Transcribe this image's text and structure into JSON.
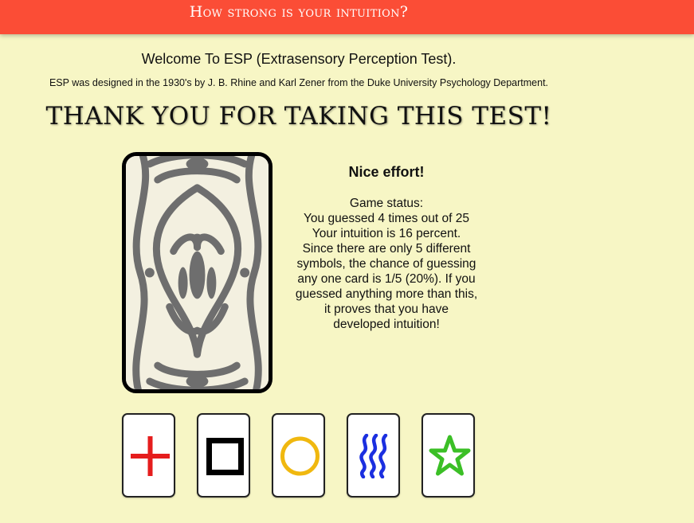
{
  "header": {
    "title": "How strong is your intuition?",
    "color": "#fb4d36"
  },
  "intro": {
    "welcome": "Welcome To ESP (Extrasensory Perception Test).",
    "subtitle": "ESP was designed in the 1930's by J. B. Rhine and Karl Zener from the Duke University Psychology Department."
  },
  "result_banner": "THANK YOU FOR TAKING THIS TEST!",
  "status": {
    "headline": "Nice effort!",
    "label": "Game status:",
    "guessed": "You guessed 4 times out of 25",
    "intuition": "Your intuition is 16 percent.",
    "explanation": "Since there are only 5 different symbols, the chance of guessing any one card is 1/5 (20%). If you guessed anything more than this, it proves that you have developed intuition!"
  },
  "symbol_cards": [
    {
      "name": "plus",
      "color": "#e51d1d"
    },
    {
      "name": "square",
      "color": "#000000"
    },
    {
      "name": "circle",
      "color": "#f0b80f"
    },
    {
      "name": "waves",
      "color": "#1b2fe0"
    },
    {
      "name": "star",
      "color": "#3bbf26"
    }
  ],
  "colors": {
    "background": "#f7f6c5",
    "card_pattern": "#6e6e6e"
  }
}
